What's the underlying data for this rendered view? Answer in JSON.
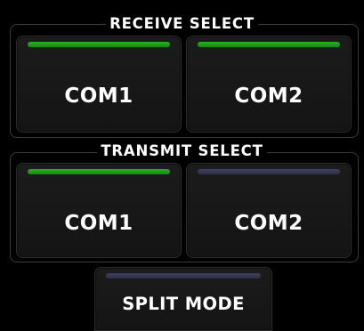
{
  "receive_select": {
    "title": "RECEIVE SELECT",
    "buttons": [
      {
        "label": "COM1",
        "active": true
      },
      {
        "label": "COM2",
        "active": true
      }
    ]
  },
  "transmit_select": {
    "title": "TRANSMIT SELECT",
    "buttons": [
      {
        "label": "COM1",
        "active": true
      },
      {
        "label": "COM2",
        "active": false
      }
    ]
  },
  "split_mode": {
    "label": "SPLIT MODE",
    "active": false
  },
  "colors": {
    "background": "#000000",
    "indicator_on": "#1e9e18",
    "indicator_off": "#34364f",
    "button_face": "#181818",
    "text": "#ffffff"
  }
}
